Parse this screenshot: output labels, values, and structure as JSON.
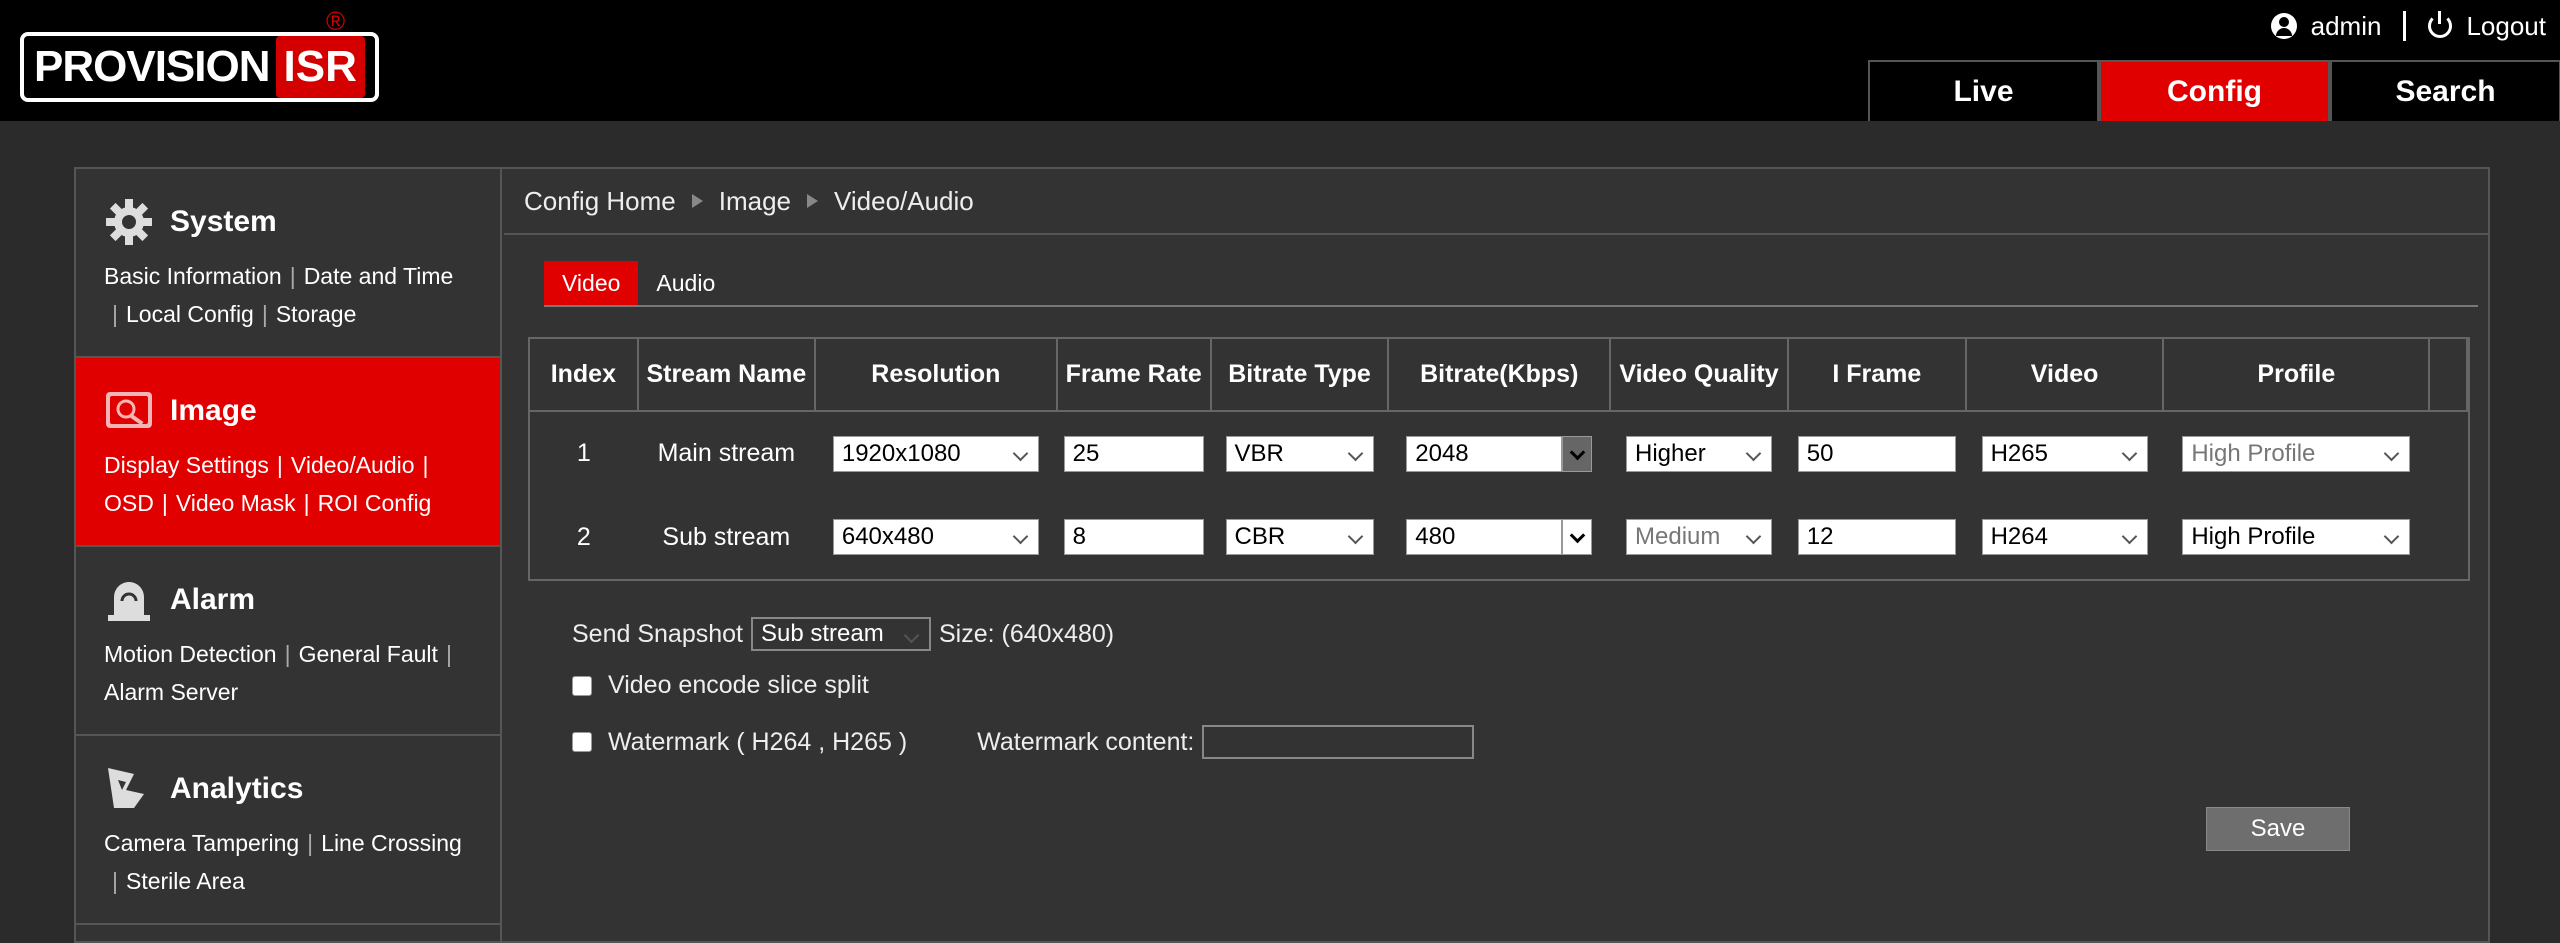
{
  "header": {
    "logo_main": "PROVISION",
    "logo_accent": "ISR",
    "logo_reg": "®",
    "user": "admin",
    "logout": "Logout",
    "nav": [
      {
        "label": "Live",
        "active": false
      },
      {
        "label": "Config",
        "active": true
      },
      {
        "label": "Search",
        "active": false
      }
    ]
  },
  "sidebar": {
    "sections": [
      {
        "title": "System",
        "icon": "gear-icon",
        "active": false,
        "links": [
          "Basic Information",
          "Date and Time",
          "Local Config",
          "Storage"
        ]
      },
      {
        "title": "Image",
        "icon": "image-icon",
        "active": true,
        "links": [
          "Display Settings",
          "Video/Audio",
          "OSD",
          "Video Mask",
          "ROI Config"
        ]
      },
      {
        "title": "Alarm",
        "icon": "alarm-icon",
        "active": false,
        "links": [
          "Motion Detection",
          "General Fault",
          "Alarm Server"
        ]
      },
      {
        "title": "Analytics",
        "icon": "analytics-icon",
        "active": false,
        "links": [
          "Camera Tampering",
          "Line Crossing",
          "Sterile Area"
        ]
      }
    ]
  },
  "breadcrumb": [
    "Config Home",
    "Image",
    "Video/Audio"
  ],
  "subtabs": [
    {
      "label": "Video",
      "active": true
    },
    {
      "label": "Audio",
      "active": false
    }
  ],
  "table": {
    "headers": [
      "Index",
      "Stream Name",
      "Resolution",
      "Frame Rate",
      "Bitrate Type",
      "Bitrate(Kbps)",
      "Video Quality",
      "I Frame",
      "Video",
      "Profile"
    ],
    "rows": [
      {
        "index": "1",
        "name": "Main stream",
        "resolution": "1920x1080",
        "frame_rate": "25",
        "bitrate_type": "VBR",
        "bitrate": "2048",
        "quality": "Higher",
        "quality_disabled": false,
        "iframe": "50",
        "video": "H265",
        "profile": "High Profile",
        "profile_disabled": true
      },
      {
        "index": "2",
        "name": "Sub stream",
        "resolution": "640x480",
        "frame_rate": "8",
        "bitrate_type": "CBR",
        "bitrate": "480",
        "quality": "Medium",
        "quality_disabled": true,
        "iframe": "12",
        "video": "H264",
        "profile": "High Profile",
        "profile_disabled": false
      }
    ]
  },
  "options": {
    "send_snapshot_label": "Send Snapshot",
    "send_snapshot_value": "Sub stream",
    "snapshot_size": "Size: (640x480)",
    "slice_split_label": "Video encode slice split",
    "watermark_label": "Watermark ( H264 , H265 )",
    "watermark_content_label": "Watermark content:",
    "watermark_content_value": ""
  },
  "save_label": "Save",
  "colors": {
    "accent": "#e10000",
    "background": "#2b2b2b",
    "header": "#000000"
  }
}
